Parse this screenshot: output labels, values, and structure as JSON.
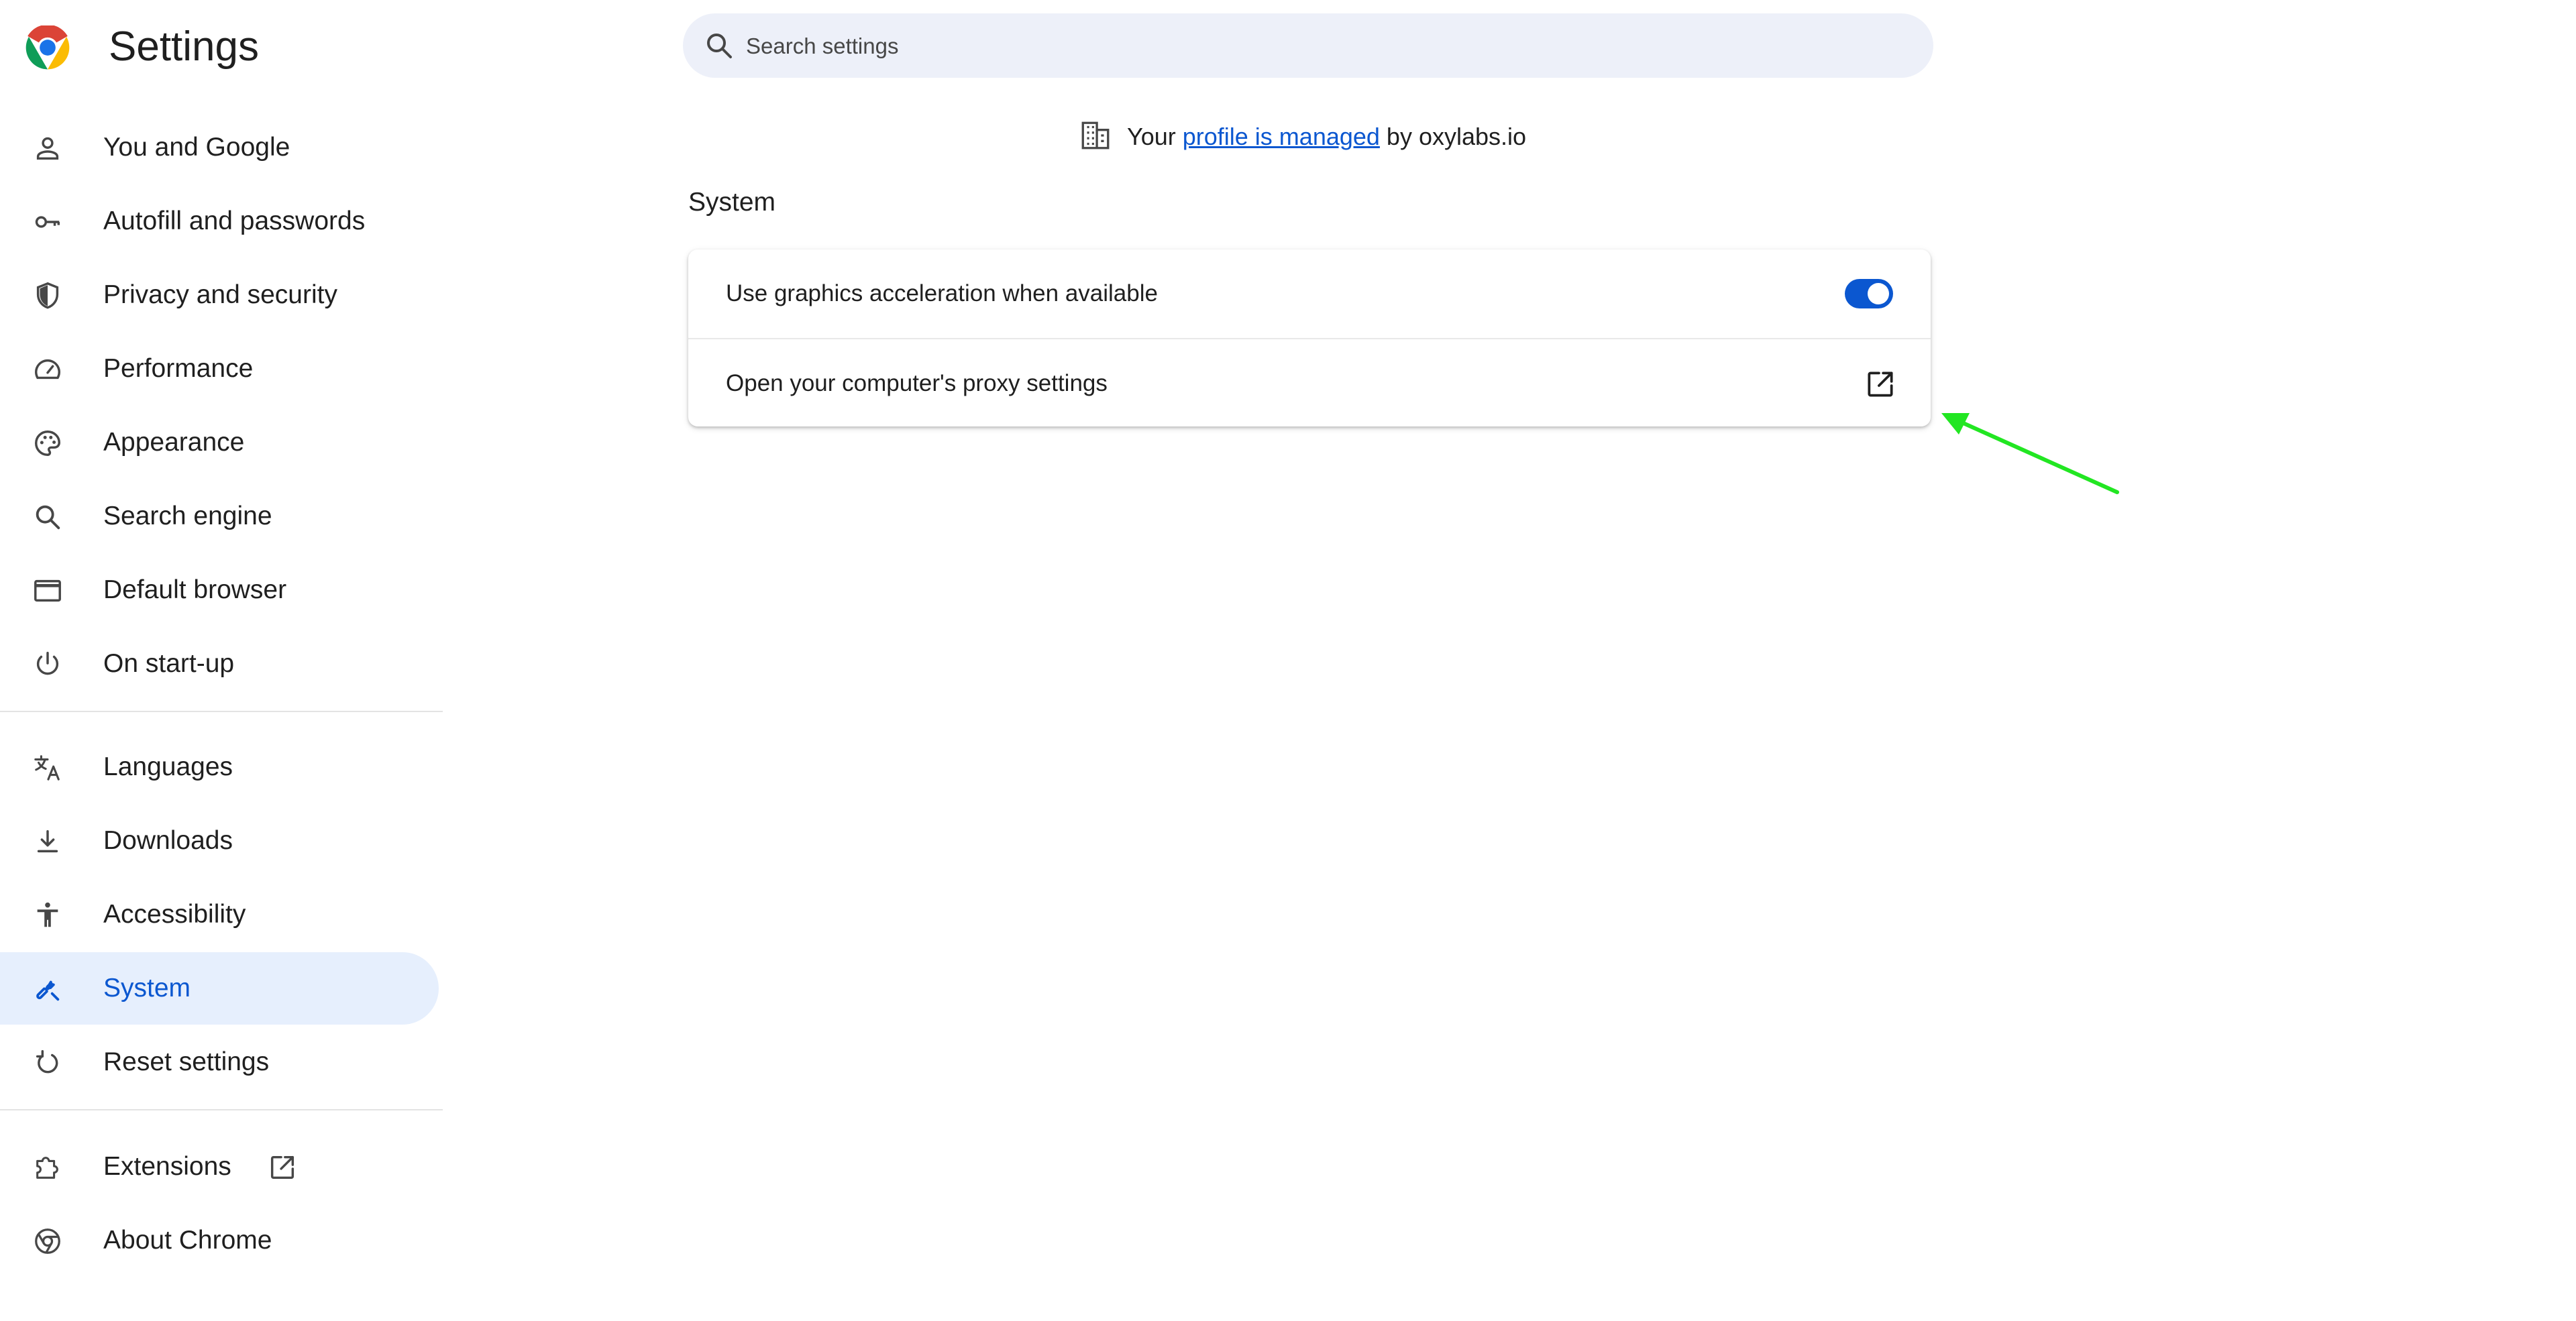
{
  "app": {
    "title": "Settings"
  },
  "search": {
    "placeholder": "Search settings",
    "value": ""
  },
  "sidebar": {
    "items": [
      {
        "label": "You and Google",
        "icon": "person-icon"
      },
      {
        "label": "Autofill and passwords",
        "icon": "key-icon"
      },
      {
        "label": "Privacy and security",
        "icon": "shield-icon"
      },
      {
        "label": "Performance",
        "icon": "speedometer-icon"
      },
      {
        "label": "Appearance",
        "icon": "palette-icon"
      },
      {
        "label": "Search engine",
        "icon": "search-icon"
      },
      {
        "label": "Default browser",
        "icon": "browser-window-icon"
      },
      {
        "label": "On start-up",
        "icon": "power-icon"
      },
      {
        "label": "Languages",
        "icon": "translate-icon"
      },
      {
        "label": "Downloads",
        "icon": "download-icon"
      },
      {
        "label": "Accessibility",
        "icon": "accessibility-icon"
      },
      {
        "label": "System",
        "icon": "wrench-icon",
        "active": true
      },
      {
        "label": "Reset settings",
        "icon": "reset-icon"
      },
      {
        "label": "Extensions",
        "icon": "puzzle-icon"
      },
      {
        "label": "About Chrome",
        "icon": "chrome-icon"
      }
    ]
  },
  "managed_notice": {
    "prefix": "Your ",
    "link": "profile is managed",
    "suffix": " by oxylabs.io"
  },
  "section": {
    "title": "System",
    "rows": [
      {
        "label": "Use graphics acceleration when available",
        "control": "toggle",
        "checked": true
      },
      {
        "label": "Open your computer's proxy settings",
        "control": "open-external-icon"
      }
    ]
  },
  "colors": {
    "accent": "#0b57d0",
    "active_nav_bg": "#e6effd",
    "search_bg": "#edf0f9",
    "annotation_arrow": "#22e622"
  }
}
